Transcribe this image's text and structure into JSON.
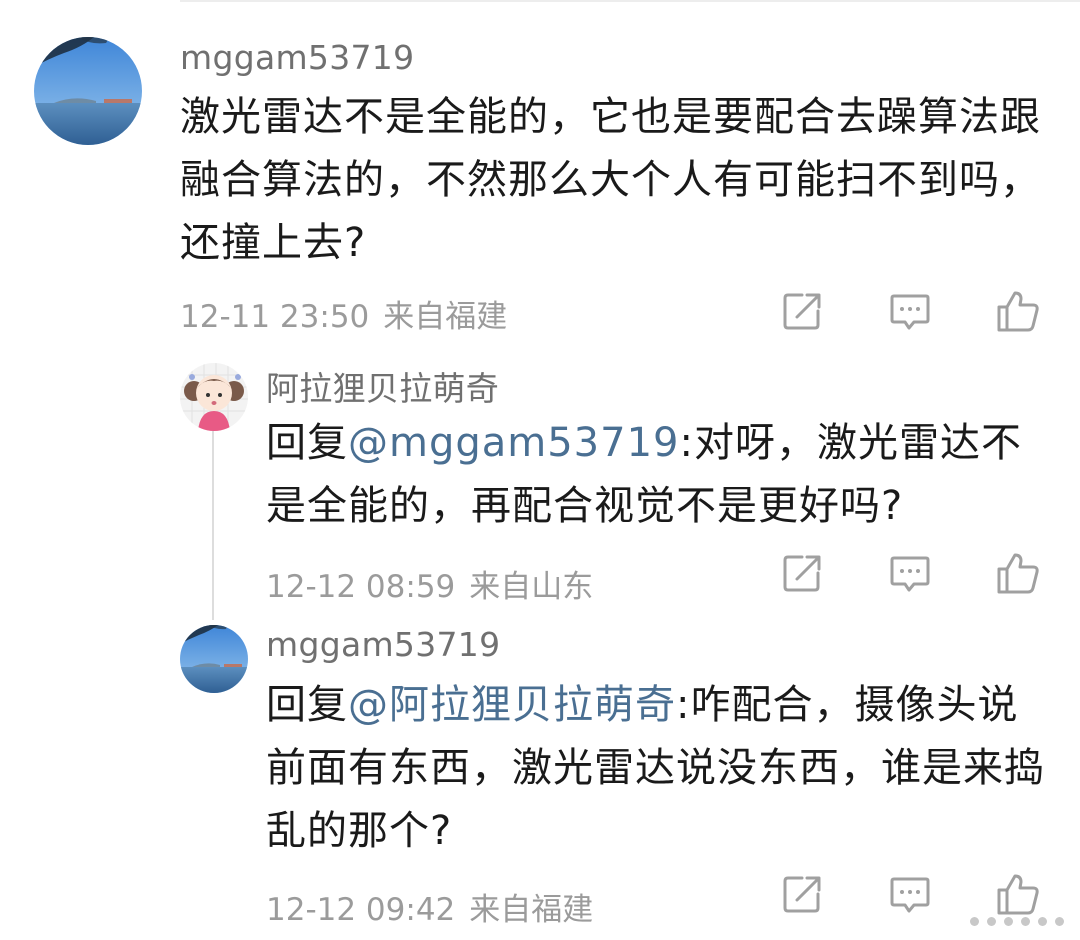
{
  "comments": [
    {
      "username": "mggam53719",
      "text": "激光雷达不是全能的，它也是要配合去躁算法跟融合算法的，不然那么大个人有可能扫不到吗，还撞上去?",
      "time": "12-11 23:50",
      "location": "来自福建",
      "avatar_icon": "lake-landscape-avatar"
    },
    {
      "username": "阿拉狸贝拉萌奇",
      "reply_prefix": "回复",
      "mention": "@mggam53719",
      "text": ":对呀，激光雷达不是全能的，再配合视觉不是更好吗?",
      "time": "12-12 08:59",
      "location": "来自山东",
      "avatar_icon": "cartoon-girl-avatar"
    },
    {
      "username": "mggam53719",
      "reply_prefix": "回复",
      "mention": "@阿拉狸贝拉萌奇",
      "text": ":咋配合，摄像头说前面有东西，激光雷达说没东西，谁是来捣乱的那个?",
      "time": "12-12 09:42",
      "location": "来自福建",
      "avatar_icon": "lake-landscape-avatar"
    }
  ],
  "action_icons": [
    "share-icon",
    "comment-icon",
    "like-icon"
  ],
  "colors": {
    "username": "#707070",
    "text": "#1a1a1a",
    "mention": "#4a6f92",
    "meta": "#9b9b9b",
    "icon": "#a0a0a0"
  }
}
